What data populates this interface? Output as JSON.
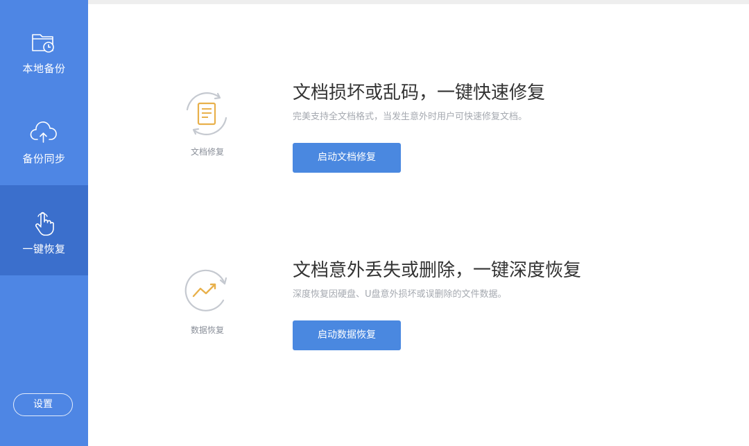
{
  "sidebar": {
    "items": [
      {
        "label": "本地备份",
        "icon": "folder-clock-icon",
        "active": false
      },
      {
        "label": "备份同步",
        "icon": "cloud-upload-icon",
        "active": false
      },
      {
        "label": "一键恢复",
        "icon": "hand-pointer-icon",
        "active": true
      }
    ],
    "settings_label": "设置"
  },
  "features": [
    {
      "icon": "document-repair-icon",
      "icon_label": "文档修复",
      "title": "文档损坏或乱码，一键快速修复",
      "description": "完美支持全文档格式，当发生意外时用户可快速修复文档。",
      "button_label": "启动文档修复"
    },
    {
      "icon": "data-recovery-icon",
      "icon_label": "数据恢复",
      "title": "文档意外丢失或删除，一键深度恢复",
      "description": "深度恢复因硬盘、U盘意外损坏或误删除的文件数据。",
      "button_label": "启动数据恢复"
    }
  ],
  "colors": {
    "sidebar_bg": "#4e86e4",
    "sidebar_active": "#3b6fcc",
    "button_bg": "#4a88e0",
    "icon_accent": "#e8b04a",
    "icon_ring": "#c5c9d0"
  }
}
